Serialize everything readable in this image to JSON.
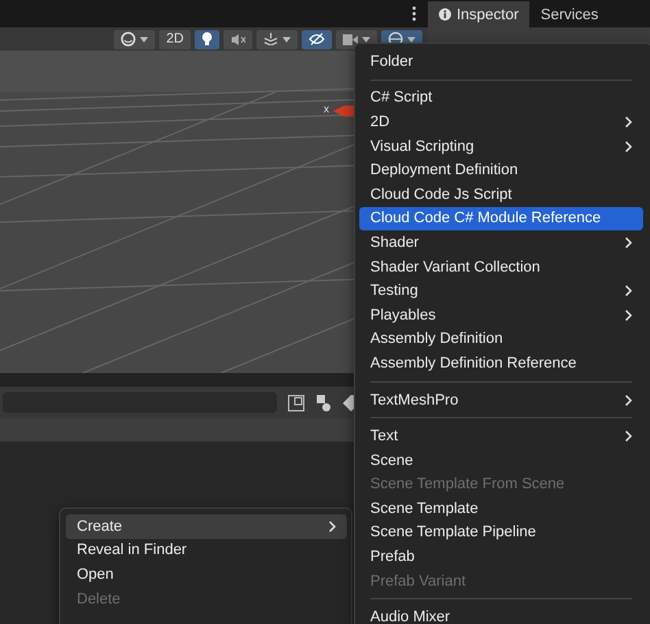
{
  "panel_tabs": [
    {
      "label": "Inspector",
      "selected": true
    },
    {
      "label": "Services",
      "selected": false
    }
  ],
  "scene_toolbar": [
    {
      "kind": "shading",
      "selected": false
    },
    {
      "kind": "text",
      "label": "2D",
      "selected": false
    },
    {
      "kind": "light",
      "selected": true
    },
    {
      "kind": "audio",
      "selected": false
    },
    {
      "kind": "effects",
      "selected": false
    },
    {
      "kind": "visibility",
      "selected": true
    },
    {
      "kind": "camera",
      "selected": false
    },
    {
      "kind": "gizmos",
      "selected": true
    }
  ],
  "scene": {
    "axis_label": "x"
  },
  "project_menu": [
    {
      "label": "Create",
      "selected": true,
      "disabled": false,
      "submenu": true
    },
    {
      "label": "Reveal in Finder",
      "selected": false,
      "disabled": false,
      "submenu": false
    },
    {
      "label": "Open",
      "selected": false,
      "disabled": false,
      "submenu": false
    },
    {
      "label": "Delete",
      "selected": false,
      "disabled": true,
      "submenu": false
    }
  ],
  "create_menu": [
    {
      "kind": "item",
      "label": "Folder",
      "selected": false,
      "disabled": false,
      "submenu": false
    },
    {
      "kind": "separator"
    },
    {
      "kind": "item",
      "label": "C# Script",
      "selected": false,
      "disabled": false,
      "submenu": false
    },
    {
      "kind": "item",
      "label": "2D",
      "selected": false,
      "disabled": false,
      "submenu": true
    },
    {
      "kind": "item",
      "label": "Visual Scripting",
      "selected": false,
      "disabled": false,
      "submenu": true
    },
    {
      "kind": "item",
      "label": "Deployment Definition",
      "selected": false,
      "disabled": false,
      "submenu": false
    },
    {
      "kind": "item",
      "label": "Cloud Code Js Script",
      "selected": false,
      "disabled": false,
      "submenu": false
    },
    {
      "kind": "item",
      "label": "Cloud Code C# Module Reference",
      "selected": true,
      "disabled": false,
      "submenu": false
    },
    {
      "kind": "item",
      "label": "Shader",
      "selected": false,
      "disabled": false,
      "submenu": true
    },
    {
      "kind": "item",
      "label": "Shader Variant Collection",
      "selected": false,
      "disabled": false,
      "submenu": false
    },
    {
      "kind": "item",
      "label": "Testing",
      "selected": false,
      "disabled": false,
      "submenu": true
    },
    {
      "kind": "item",
      "label": "Playables",
      "selected": false,
      "disabled": false,
      "submenu": true
    },
    {
      "kind": "item",
      "label": "Assembly Definition",
      "selected": false,
      "disabled": false,
      "submenu": false
    },
    {
      "kind": "item",
      "label": "Assembly Definition Reference",
      "selected": false,
      "disabled": false,
      "submenu": false
    },
    {
      "kind": "separator"
    },
    {
      "kind": "item",
      "label": "TextMeshPro",
      "selected": false,
      "disabled": false,
      "submenu": true
    },
    {
      "kind": "separator"
    },
    {
      "kind": "item",
      "label": "Text",
      "selected": false,
      "disabled": false,
      "submenu": true
    },
    {
      "kind": "item",
      "label": "Scene",
      "selected": false,
      "disabled": false,
      "submenu": false
    },
    {
      "kind": "item",
      "label": "Scene Template From Scene",
      "selected": false,
      "disabled": true,
      "submenu": false
    },
    {
      "kind": "item",
      "label": "Scene Template",
      "selected": false,
      "disabled": false,
      "submenu": false
    },
    {
      "kind": "item",
      "label": "Scene Template Pipeline",
      "selected": false,
      "disabled": false,
      "submenu": false
    },
    {
      "kind": "item",
      "label": "Prefab",
      "selected": false,
      "disabled": false,
      "submenu": false
    },
    {
      "kind": "item",
      "label": "Prefab Variant",
      "selected": false,
      "disabled": true,
      "submenu": false
    },
    {
      "kind": "separator"
    },
    {
      "kind": "item",
      "label": "Audio Mixer",
      "selected": false,
      "disabled": false,
      "submenu": false
    }
  ]
}
